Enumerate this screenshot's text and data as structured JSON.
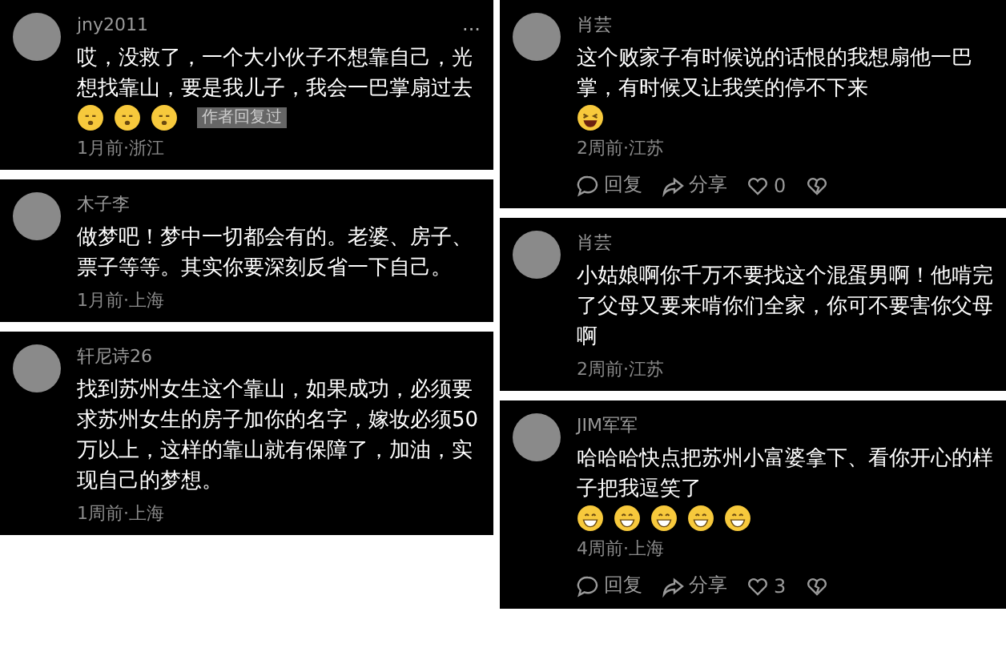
{
  "columns": [
    {
      "comments": [
        {
          "author": "jny2011",
          "more": "...",
          "text": "哎，没救了，一个大小伙子不想靠自己，光想找靠山，要是我儿子，我会一巴掌扇过去",
          "emojis": [
            {
              "kind": "sleepy"
            },
            {
              "kind": "sleepy"
            },
            {
              "kind": "sleepy"
            }
          ],
          "badge": "作者回复过",
          "meta": "1月前·浙江"
        },
        {
          "author": "木子李",
          "text": "做梦吧！梦中一切都会有的。老婆、房子、票子等等。其实你要深刻反省一下自己。",
          "meta": "1月前·上海"
        },
        {
          "author": "轩尼诗26",
          "text": "找到苏州女生这个靠山，如果成功，必须要求苏州女生的房子加你的名字，嫁妆必须50万以上，这样的靠山就有保障了，加油，实现自己的梦想。",
          "meta": "1周前·上海"
        }
      ]
    },
    {
      "comments": [
        {
          "author": "肖芸",
          "text": "这个败家子有时候说的话恨的我想扇他一巴掌，有时候又让我笑的停不下来",
          "emojis": [
            {
              "kind": "laughing"
            }
          ],
          "meta": "2周前·江苏",
          "actions": {
            "reply": "回复",
            "share": "分享",
            "likes": "0"
          }
        },
        {
          "author": "肖芸",
          "text": "小姑娘啊你千万不要找这个混蛋男啊！他啃完了父母又要来啃你们全家，你可不要害你父母啊",
          "meta": "2周前·江苏"
        },
        {
          "author": "JIM军军",
          "text": "哈哈哈快点把苏州小富婆拿下、看你开心的样子把我逗笑了",
          "emojis": [
            {
              "kind": "grin"
            },
            {
              "kind": "grin"
            },
            {
              "kind": "grin"
            },
            {
              "kind": "grin"
            },
            {
              "kind": "grin"
            }
          ],
          "meta": "4周前·上海",
          "actions": {
            "reply": "回复",
            "share": "分享",
            "likes": "3"
          }
        }
      ]
    }
  ]
}
